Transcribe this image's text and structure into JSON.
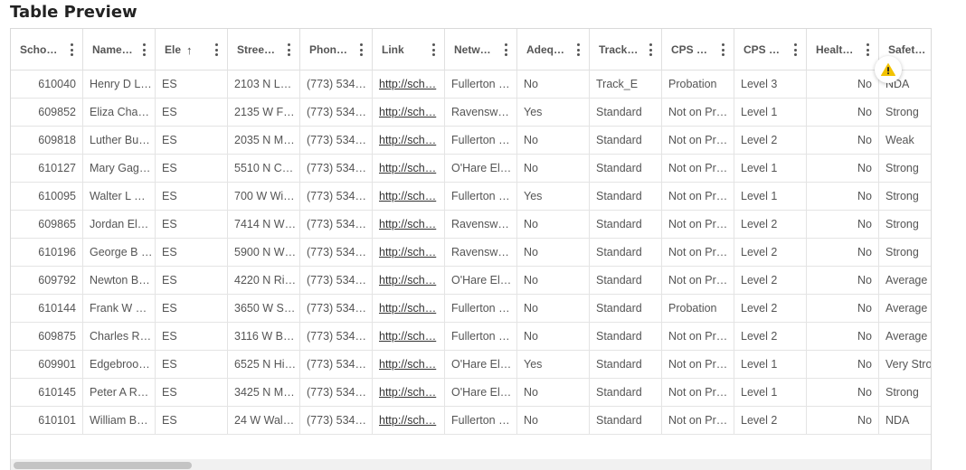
{
  "page": {
    "title": "Table Preview"
  },
  "table": {
    "columns": [
      {
        "label": "Scho…",
        "sort": ""
      },
      {
        "label": "Name…",
        "sort": ""
      },
      {
        "label": "Ele",
        "sort": "↑"
      },
      {
        "label": "Stree…",
        "sort": ""
      },
      {
        "label": "Phon…",
        "sort": ""
      },
      {
        "label": "Link",
        "sort": ""
      },
      {
        "label": "Netw…",
        "sort": ""
      },
      {
        "label": "Adeq…",
        "sort": ""
      },
      {
        "label": "Track…",
        "sort": ""
      },
      {
        "label": "CPS …",
        "sort": ""
      },
      {
        "label": "CPS …",
        "sort": ""
      },
      {
        "label": "Healt…",
        "sort": ""
      },
      {
        "label": "Safet…",
        "sort": ""
      }
    ],
    "rows": [
      [
        "610040",
        "Henry D L…",
        "ES",
        "2103 N L…",
        "(773) 534…",
        "http://sch…",
        "Fullerton …",
        "No",
        "Track_E",
        "Probation",
        "Level 3",
        "No",
        "NDA"
      ],
      [
        "609852",
        "Eliza Cha…",
        "ES",
        "2135 W F…",
        "(773) 534…",
        "http://sch…",
        "Ravensw…",
        "Yes",
        "Standard",
        "Not on Pr…",
        "Level 1",
        "No",
        "Strong"
      ],
      [
        "609818",
        "Luther Bu…",
        "ES",
        "2035 N M…",
        "(773) 534…",
        "http://sch…",
        "Fullerton …",
        "No",
        "Standard",
        "Not on Pr…",
        "Level 2",
        "No",
        "Weak"
      ],
      [
        "610127",
        "Mary Gag…",
        "ES",
        "5510 N C…",
        "(773) 534…",
        "http://sch…",
        "O'Hare El…",
        "No",
        "Standard",
        "Not on Pr…",
        "Level 1",
        "No",
        "Strong"
      ],
      [
        "610095",
        "Walter L …",
        "ES",
        "700 W Wi…",
        "(773) 534…",
        "http://sch…",
        "Fullerton …",
        "Yes",
        "Standard",
        "Not on Pr…",
        "Level 1",
        "No",
        "Strong"
      ],
      [
        "609865",
        "Jordan El…",
        "ES",
        "7414 N W…",
        "(773) 534…",
        "http://sch…",
        "Ravensw…",
        "No",
        "Standard",
        "Not on Pr…",
        "Level 2",
        "No",
        "Strong"
      ],
      [
        "610196",
        "George B …",
        "ES",
        "5900 N W…",
        "(773) 534…",
        "http://sch…",
        "Ravensw…",
        "No",
        "Standard",
        "Not on Pr…",
        "Level 2",
        "No",
        "Strong"
      ],
      [
        "609792",
        "Newton B…",
        "ES",
        "4220 N Ri…",
        "(773) 534…",
        "http://sch…",
        "O'Hare El…",
        "No",
        "Standard",
        "Not on Pr…",
        "Level 2",
        "No",
        "Average"
      ],
      [
        "610144",
        "Frank W …",
        "ES",
        "3650 W S…",
        "(773) 534…",
        "http://sch…",
        "Fullerton …",
        "No",
        "Standard",
        "Probation",
        "Level 2",
        "No",
        "Average"
      ],
      [
        "609875",
        "Charles R…",
        "ES",
        "3116 W B…",
        "(773) 534…",
        "http://sch…",
        "Fullerton …",
        "No",
        "Standard",
        "Not on Pr…",
        "Level 2",
        "No",
        "Average"
      ],
      [
        "609901",
        "Edgebroo…",
        "ES",
        "6525 N Hi…",
        "(773) 534…",
        "http://sch…",
        "O'Hare El…",
        "Yes",
        "Standard",
        "Not on Pr…",
        "Level 1",
        "No",
        "Very Stro"
      ],
      [
        "610145",
        "Peter A R…",
        "ES",
        "3425 N M…",
        "(773) 534…",
        "http://sch…",
        "O'Hare El…",
        "No",
        "Standard",
        "Not on Pr…",
        "Level 1",
        "No",
        "Strong"
      ],
      [
        "610101",
        "William B…",
        "ES",
        "24 W Wal…",
        "(773) 534…",
        "http://sch…",
        "Fullerton …",
        "No",
        "Standard",
        "Not on Pr…",
        "Level 2",
        "No",
        "NDA"
      ]
    ],
    "numeric_columns": [
      0,
      11
    ],
    "link_columns": [
      5
    ]
  },
  "icons": {
    "warning": "warning-triangle-icon",
    "column_menu": "kebab-menu-icon",
    "sort": "sort-ascending-icon"
  },
  "colors": {
    "warning": "#f2c200",
    "scrollbar_thumb": "#c4c4c4"
  }
}
